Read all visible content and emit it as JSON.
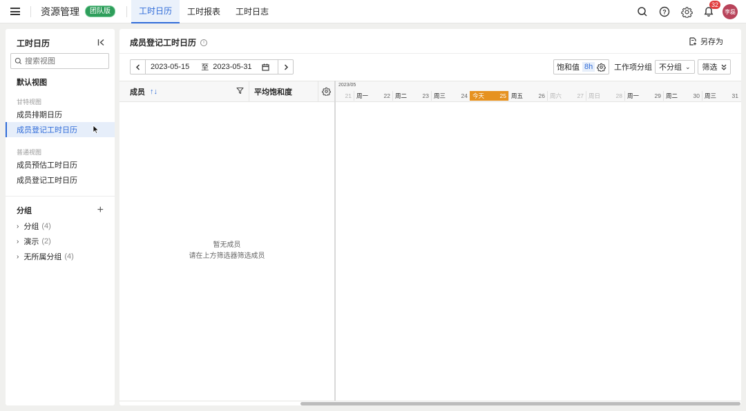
{
  "topbar": {
    "app_title": "资源管理",
    "badge": "团队版",
    "tabs": [
      {
        "label": "工时日历",
        "active": true
      },
      {
        "label": "工时报表",
        "active": false
      },
      {
        "label": "工时日志",
        "active": false
      }
    ],
    "notification_count": "32",
    "avatar_text": "李磊",
    "icons": [
      "menu-icon",
      "search-icon",
      "help-icon",
      "gear-icon",
      "bell-icon"
    ]
  },
  "sidebar": {
    "title": "工时日历",
    "search_placeholder": "搜索视图",
    "default_view": "默认视图",
    "gantt_caption": "甘特视图",
    "gantt_items": [
      "成员排期日历",
      "成员登记工时日历"
    ],
    "normal_caption": "普通视图",
    "normal_items": [
      "成员预估工时日历",
      "成员登记工时日历"
    ],
    "group_title": "分组",
    "groups": [
      {
        "name": "分组",
        "count": "(4)"
      },
      {
        "name": "演示",
        "count": "(2)"
      },
      {
        "name": "无所属分组",
        "count": "(4)"
      }
    ]
  },
  "main": {
    "title": "成员登记工时日历",
    "save_as": "另存为",
    "date_start": "2023-05-15",
    "date_sep": "至",
    "date_end": "2023-05-31",
    "saturation_label": "饱和值",
    "saturation_value": "8h",
    "group_label": "工作项分组",
    "group_value": "不分组",
    "filter_label": "筛选",
    "col_member": "成员",
    "col_saturation": "平均饱和度",
    "month_label": "2023/05",
    "days": [
      {
        "num": "21",
        "wd": "",
        "type": "first"
      },
      {
        "num": "22",
        "wd": "周一",
        "type": "normal"
      },
      {
        "num": "23",
        "wd": "周二",
        "type": "normal"
      },
      {
        "num": "24",
        "wd": "周三",
        "type": "normal"
      },
      {
        "num": "25",
        "wd": "今天",
        "type": "today"
      },
      {
        "num": "26",
        "wd": "周五",
        "type": "normal"
      },
      {
        "num": "27",
        "wd": "周六",
        "type": "weekend"
      },
      {
        "num": "28",
        "wd": "周日",
        "type": "weekend"
      },
      {
        "num": "29",
        "wd": "周一",
        "type": "normal"
      },
      {
        "num": "30",
        "wd": "周二",
        "type": "normal"
      },
      {
        "num": "31",
        "wd": "周三",
        "type": "normal"
      }
    ],
    "empty_title": "暂无成员",
    "empty_hint": "请在上方筛选器筛选成员"
  },
  "colors": {
    "accent": "#2f6bd8",
    "today": "#e69220",
    "badge": "#2e9e5b",
    "notif": "#e03b3b",
    "avatar": "#b8435a"
  }
}
